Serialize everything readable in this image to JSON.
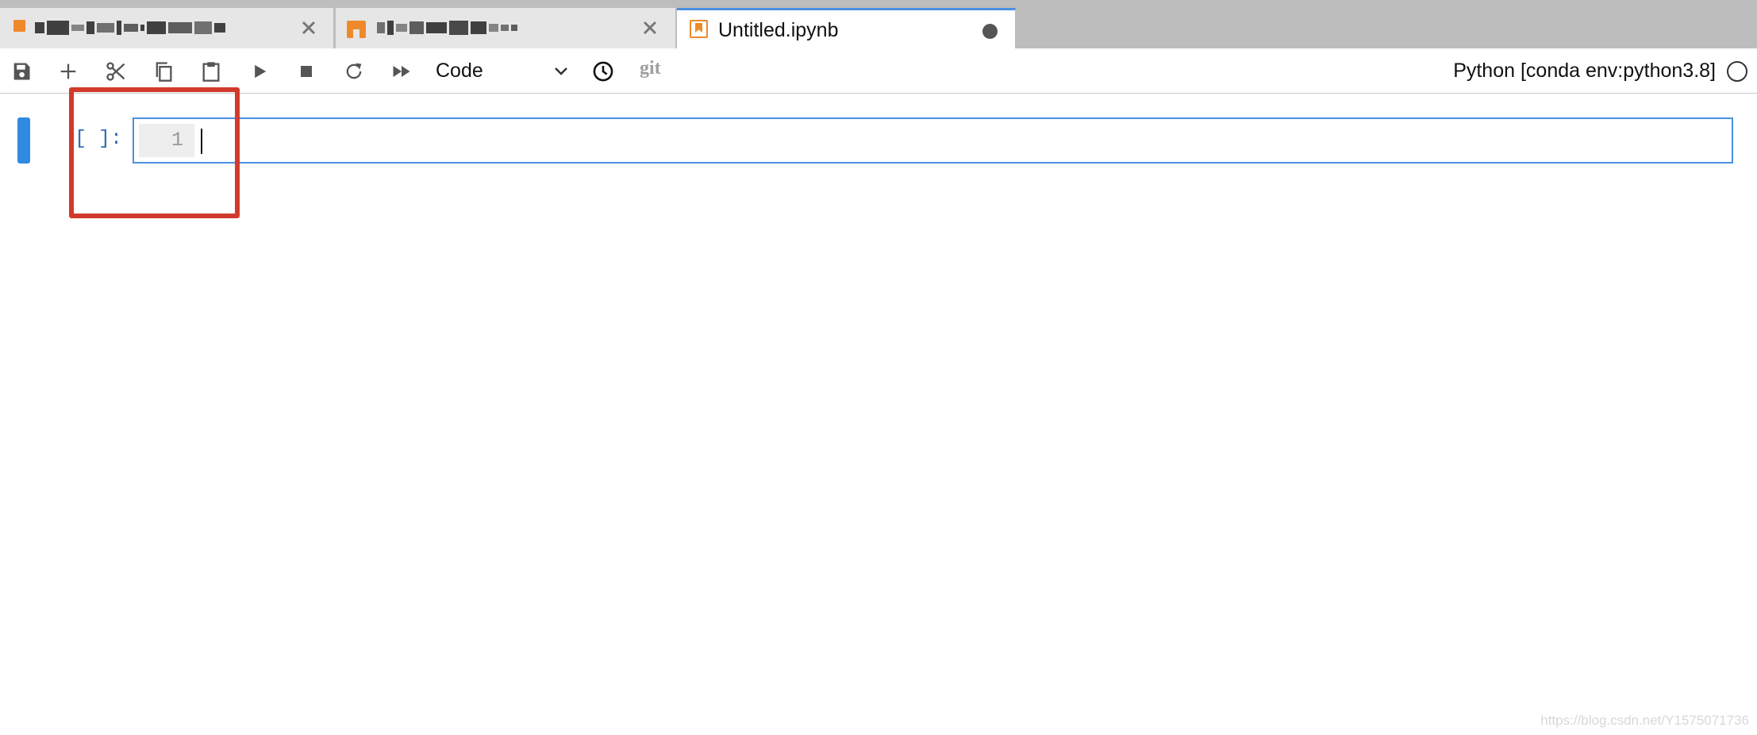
{
  "tabs": [
    {
      "title_redacted": true,
      "icon": "document-icon"
    },
    {
      "title_redacted": true,
      "icon": "notebook-icon"
    },
    {
      "title": "Untitled.ipynb",
      "icon": "notebook-icon",
      "active": true,
      "unsaved": true
    }
  ],
  "toolbar": {
    "buttons": [
      "save-icon",
      "add-cell-icon",
      "cut-icon",
      "copy-icon",
      "paste-icon",
      "run-icon",
      "stop-icon",
      "restart-icon",
      "run-all-icon"
    ],
    "cell_type": "Code",
    "git_label": "git",
    "kernel_name": "Python [conda env:python3.8]"
  },
  "cell": {
    "prompt": "[ ]:",
    "line_number": "1",
    "content": ""
  },
  "watermark": "https://blog.csdn.net/Y1575071736",
  "colors": {
    "accent": "#4a90e2",
    "collapser": "#2f8ae0",
    "highlight": "#d13a2c",
    "notebook_orange": "#ef8a2b"
  }
}
